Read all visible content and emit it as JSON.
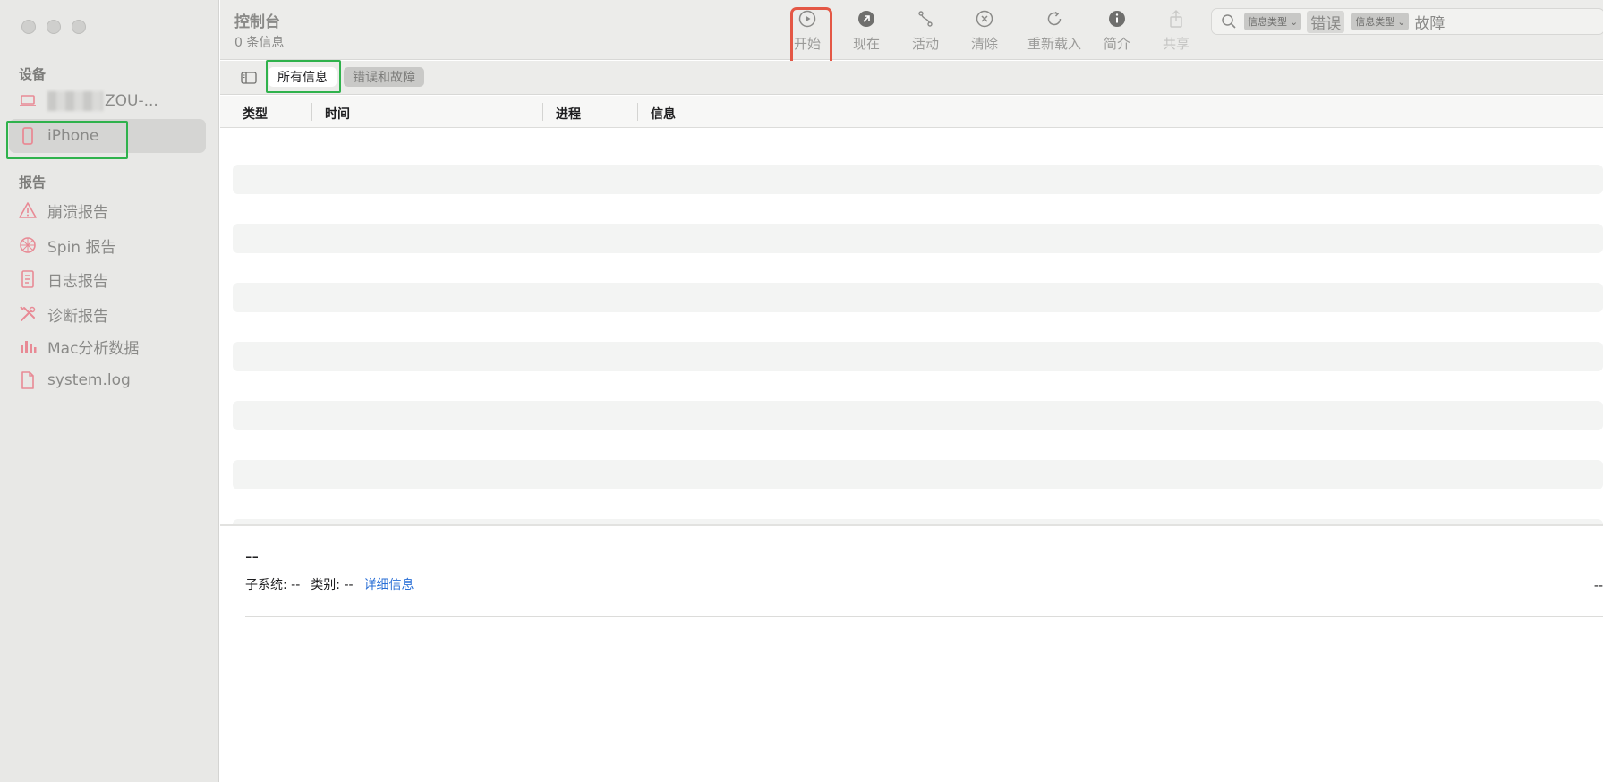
{
  "window": {
    "title": "控制台",
    "subtitle": "0 条信息"
  },
  "sidebar": {
    "devices_label": "设备",
    "devices": [
      {
        "label": "ZOU-...",
        "icon": "laptop-icon"
      },
      {
        "label": "iPhone",
        "icon": "phone-icon"
      }
    ],
    "reports_label": "报告",
    "reports": [
      {
        "label": "崩溃报告",
        "icon": "warning-icon"
      },
      {
        "label": "Spin 报告",
        "icon": "spin-icon"
      },
      {
        "label": "日志报告",
        "icon": "document-icon"
      },
      {
        "label": "诊断报告",
        "icon": "tools-icon"
      },
      {
        "label": "Mac分析数据",
        "icon": "chart-icon"
      },
      {
        "label": "system.log",
        "icon": "file-icon"
      }
    ]
  },
  "toolbar": {
    "start": "开始",
    "now": "现在",
    "activity": "活动",
    "clear": "清除",
    "reload": "重新载入",
    "info": "简介",
    "share": "共享"
  },
  "search": {
    "type_label": "信息类型",
    "token1": "错误",
    "token2": "故障"
  },
  "filters": {
    "all": "所有信息",
    "errors": "错误和故障"
  },
  "columns": {
    "type": "类型",
    "time": "时间",
    "process": "进程",
    "message": "信息"
  },
  "detail": {
    "title": "--",
    "subsystem": "子系统: --",
    "category": "类别: --",
    "more": "详细信息",
    "right": "--"
  },
  "colors": {
    "accent_red": "#e45745",
    "accent_green": "#2fb24c",
    "sidebar_icon": "#e88a95",
    "link": "#2a6fd6"
  }
}
